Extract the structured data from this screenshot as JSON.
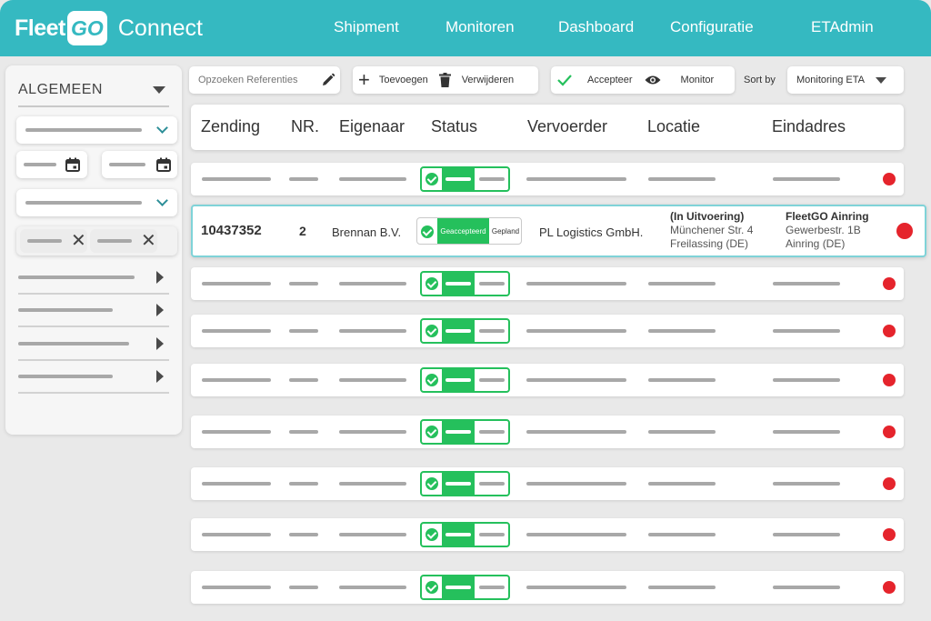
{
  "app": {
    "logo_fleet": "Fleet",
    "logo_go": "GO",
    "logo_connect": "Connect"
  },
  "nav": {
    "items": [
      {
        "label": "Shipment"
      },
      {
        "label": "Monitoren"
      },
      {
        "label": "Dashboard"
      },
      {
        "label": "Configuratie"
      },
      {
        "label": "ETAdmin"
      }
    ]
  },
  "sidebar": {
    "title": "ALGEMEEN"
  },
  "toolbar": {
    "search_placeholder": "Opzoeken Referenties",
    "add_label": "Toevoegen",
    "delete_label": "Verwijderen",
    "accept_label": "Accepteer",
    "monitor_label": "Monitor",
    "sort_by_label": "Sort by",
    "sort_value": "Monitoring ETA"
  },
  "table": {
    "columns": [
      "Zending",
      "NR.",
      "Eigenaar",
      "Status",
      "Vervoerder",
      "Locatie",
      "Eindadres"
    ],
    "expanded_row": {
      "zending": "10437352",
      "nr": "2",
      "eigenaar": "Brennan B.V.",
      "status_accepted": "Geaccepteerd",
      "status_planned": "Gepland",
      "vervoerder": "PL Logistics GmbH.",
      "locatie_status": "(In Uitvoering)",
      "locatie_street": "Münchener Str. 4",
      "locatie_city": "Freilassing (DE)",
      "eind_name": "FleetGO Ainring",
      "eind_street": "Gewerbestr. 1B",
      "eind_city": "Ainring (DE)"
    }
  },
  "colors": {
    "brand": "#35b9c1",
    "status_green": "#25c05c",
    "alert_red": "#e5242c"
  }
}
